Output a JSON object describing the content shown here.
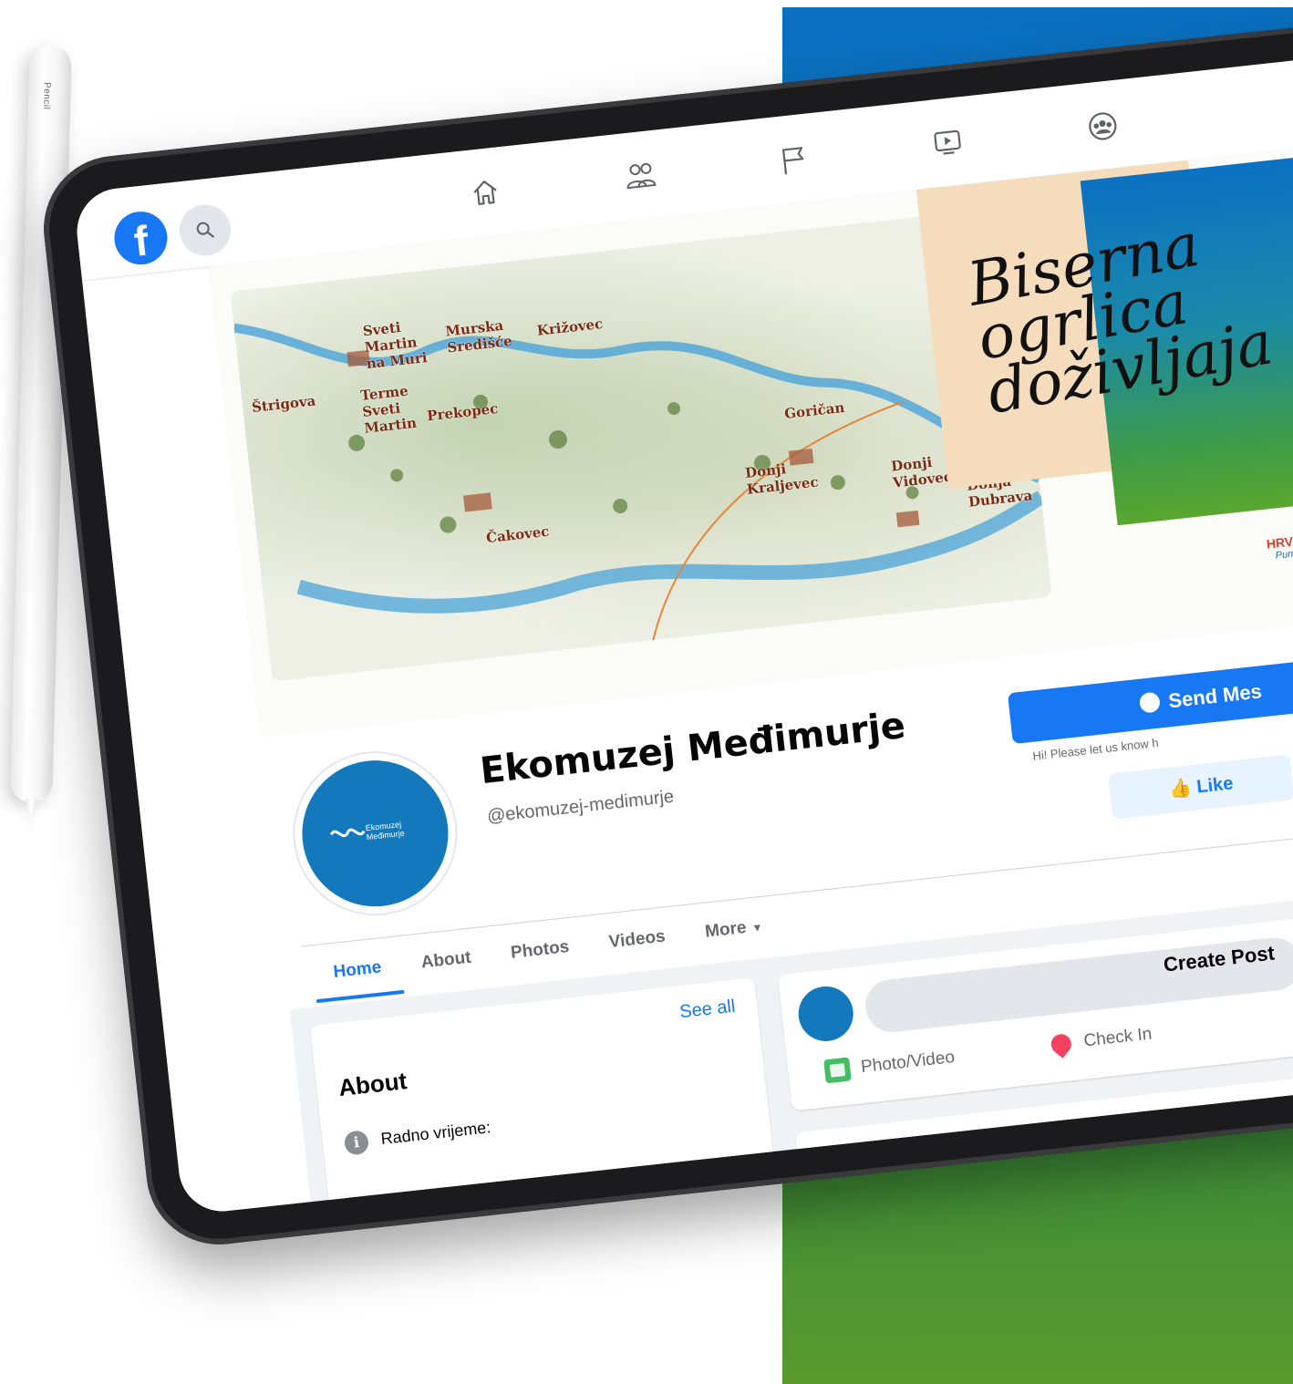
{
  "pencil": {
    "label": "Pencil"
  },
  "app": {
    "logo_letter": "f"
  },
  "nav": {
    "icons": [
      "home-icon",
      "friends-icon",
      "pages-flag-icon",
      "watch-video-icon",
      "groups-icon"
    ]
  },
  "cover": {
    "script_lines": [
      "Biserna",
      "ogrlica",
      "doživljaja"
    ],
    "tourism_logo": "HRVATSKA",
    "tourism_sub": "Puna Života",
    "map_labels": [
      "Štrigova",
      "Sveti Martin na Muri",
      "Murska Središće",
      "Križovec",
      "Terme Sveti Martin",
      "Prekopec",
      "Goričan",
      "Donji Kraljevec",
      "Čakovec",
      "Donji Vidovec",
      "Donja Dubrava"
    ]
  },
  "profile": {
    "name": "Ekomuzej Međimurje",
    "handle": "@ekomuzej-medimurje",
    "avatar_text_line1": "Ekomuzej",
    "avatar_text_line2": "Međimurje",
    "send_message": "Send Mes",
    "send_hint": "Hi! Please let us know h",
    "like": "Like"
  },
  "tabs": [
    {
      "label": "Home",
      "active": true
    },
    {
      "label": "About"
    },
    {
      "label": "Photos"
    },
    {
      "label": "Videos"
    },
    {
      "label": "More"
    }
  ],
  "about": {
    "title": "About",
    "see_all": "See all",
    "rows": [
      "Radno vrijeme:",
      ""
    ]
  },
  "create_post": {
    "label": "Create Post",
    "photo_video": "Photo/Video",
    "check_in": "Check In"
  },
  "colors": {
    "facebook_blue": "#1877f2",
    "avatar_blue": "#1478bd",
    "panel_blue": "#0a6fc0",
    "panel_green": "#5a9a2e"
  }
}
